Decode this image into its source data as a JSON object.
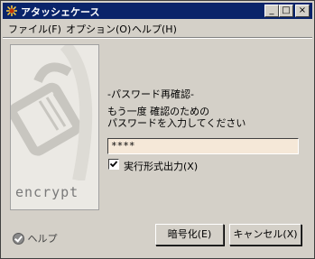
{
  "window": {
    "title": "アタッシェケース",
    "minimize": "_",
    "maximize": "□",
    "close": "×"
  },
  "menu": {
    "file": "ファイル(F)",
    "options": "オプション(O)",
    "help": "ヘルプ(H)"
  },
  "panel": {
    "caption": "encrypt"
  },
  "main": {
    "heading": "-パスワード再確認-",
    "line1": "もう一度 確認のための",
    "line2": "パスワードを入力してください",
    "password_value": "****",
    "checkbox_label": "実行形式出力(X)",
    "checkbox_checked": true
  },
  "footer": {
    "help": "ヘルプ",
    "encrypt_button": "暗号化(E)",
    "cancel_button": "キャンセル(X)"
  }
}
